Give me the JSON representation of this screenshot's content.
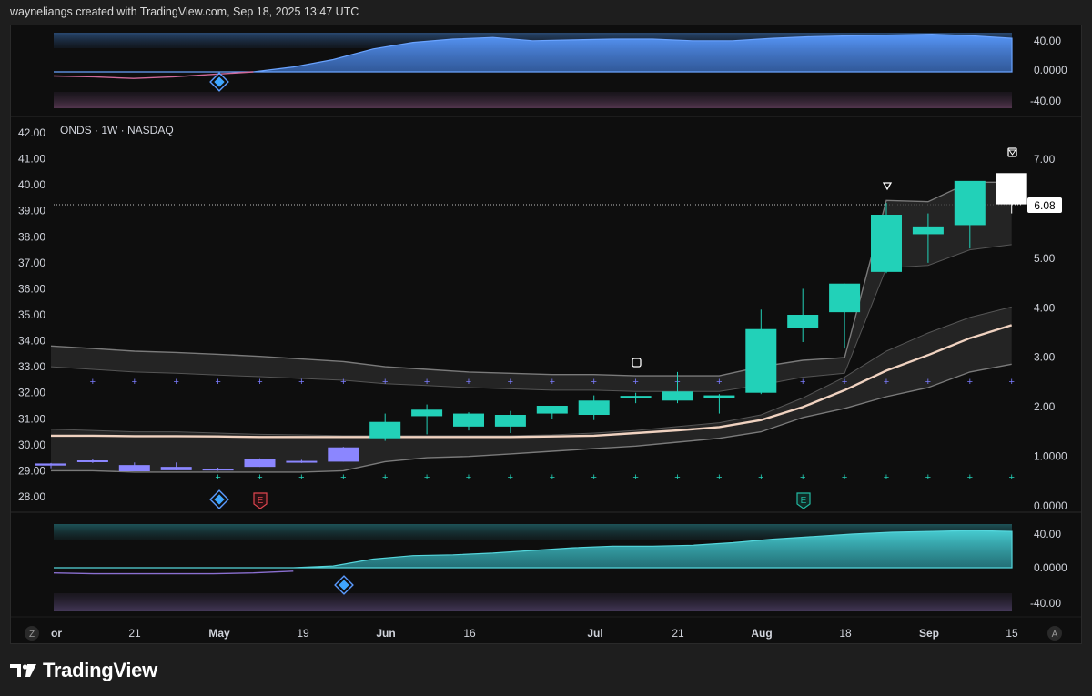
{
  "header": {
    "attribution": "wayneliangs created with TradingView.com, Sep 18, 2025 13:47 UTC"
  },
  "footer": {
    "brand": "TradingView"
  },
  "buttons": {
    "left": "Z",
    "right": "A"
  },
  "chart_data": {
    "type": "candlestick",
    "symbol_label": "ONDS · 1W · NASDAQ",
    "last_price_label": "6.08",
    "left_axis": {
      "ticks": [
        "42.00",
        "41.00",
        "40.00",
        "39.00",
        "38.00",
        "37.00",
        "36.00",
        "35.00",
        "34.00",
        "33.00",
        "32.00",
        "31.00",
        "30.00",
        "29.00",
        "28.00"
      ],
      "range": [
        28,
        42
      ]
    },
    "right_axis": {
      "ticks": [
        "7.00",
        "6.00",
        "5.00",
        "4.00",
        "3.00",
        "2.00",
        "1.0000",
        "0.0000"
      ],
      "range": [
        0,
        7
      ]
    },
    "x_ticks": [
      "or",
      "21",
      "May",
      "19",
      "Jun",
      "16",
      "Jul",
      "21",
      "Aug",
      "18",
      "Sep",
      "15"
    ],
    "candles": [
      {
        "o": 29.2,
        "h": 29.3,
        "l": 29.1,
        "c": 29.28
      },
      {
        "o": 29.4,
        "h": 29.45,
        "l": 29.3,
        "c": 29.35
      },
      {
        "o": 29.22,
        "h": 29.32,
        "l": 28.98,
        "c": 28.98
      },
      {
        "o": 29.15,
        "h": 29.32,
        "l": 29.02,
        "c": 29.02
      },
      {
        "o": 29.08,
        "h": 29.12,
        "l": 29.0,
        "c": 29.02
      },
      {
        "o": 29.45,
        "h": 29.48,
        "l": 29.15,
        "c": 29.15
      },
      {
        "o": 29.38,
        "h": 29.42,
        "l": 29.3,
        "c": 29.32
      },
      {
        "o": 29.9,
        "h": 29.92,
        "l": 29.35,
        "c": 29.35
      },
      {
        "o": 30.25,
        "h": 31.2,
        "l": 30.15,
        "c": 30.88
      },
      {
        "o": 31.1,
        "h": 31.55,
        "l": 30.4,
        "c": 31.35
      },
      {
        "o": 30.7,
        "h": 31.25,
        "l": 30.55,
        "c": 31.2
      },
      {
        "o": 30.7,
        "h": 31.3,
        "l": 30.45,
        "c": 31.15
      },
      {
        "o": 31.2,
        "h": 31.45,
        "l": 31.0,
        "c": 31.5
      },
      {
        "o": 31.15,
        "h": 31.9,
        "l": 30.95,
        "c": 31.7
      },
      {
        "o": 31.8,
        "h": 32.0,
        "l": 31.6,
        "c": 31.88
      },
      {
        "o": 31.7,
        "h": 32.8,
        "l": 31.6,
        "c": 32.05
      },
      {
        "o": 31.8,
        "h": 31.95,
        "l": 31.2,
        "c": 31.9
      },
      {
        "o": 32.0,
        "h": 35.2,
        "l": 31.95,
        "c": 34.45
      },
      {
        "o": 34.5,
        "h": 36.0,
        "l": 33.95,
        "c": 35.0
      },
      {
        "o": 35.1,
        "h": 36.2,
        "l": 33.7,
        "c": 36.2
      },
      {
        "o": 36.65,
        "h": 39.3,
        "l": 36.6,
        "c": 38.85
      },
      {
        "o": 38.1,
        "h": 38.9,
        "l": 37.0,
        "c": 38.4
      },
      {
        "o": 38.45,
        "h": 39.4,
        "l": 37.55,
        "c": 40.15
      },
      {
        "o": 39.25,
        "h": 40.3,
        "l": 38.9,
        "c": 40.45
      }
    ],
    "top_oscillator": {
      "axis": [
        "40.00",
        "0.0000",
        "-40.00"
      ],
      "range": [
        -60,
        60
      ]
    },
    "bottom_oscillator": {
      "axis": [
        "40.00",
        "0.0000",
        "-40.00"
      ],
      "range": [
        -60,
        60
      ]
    },
    "marker_labels": {
      "earnings": "E"
    },
    "colors": {
      "up": "#22d1b8",
      "down": "#8b86ff",
      "last": "#ffffff",
      "ma": "#f0d2c0",
      "top_osc": "#4f8ff0",
      "bottom_osc": "#2fc0cc"
    }
  }
}
